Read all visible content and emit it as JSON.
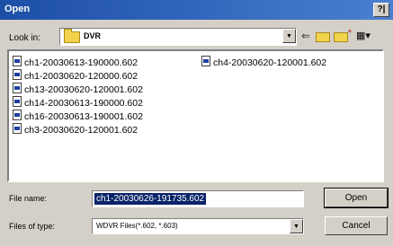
{
  "window": {
    "title": "Open",
    "help_label": "?|"
  },
  "lookin": {
    "label": "Look in:",
    "value": "DVR"
  },
  "toolbar": {
    "back_glyph": "⇐",
    "view_glyph": "▦▾"
  },
  "files": [
    "ch1-20030613-190000.602",
    "ch1-20030620-120000.602",
    "ch13-20030620-120001.602",
    "ch14-20030613-190000.602",
    "ch16-20030613-190001.602",
    "ch3-20030620-120001.602",
    "ch4-20030620-120001.602"
  ],
  "file_name": {
    "label": "File name:",
    "value": "ch1-20030626-191735.602"
  },
  "file_type": {
    "label": "Files of type:",
    "value": "WDVR Files(*.602, *.603)"
  },
  "buttons": {
    "open": "Open",
    "cancel": "Cancel"
  }
}
